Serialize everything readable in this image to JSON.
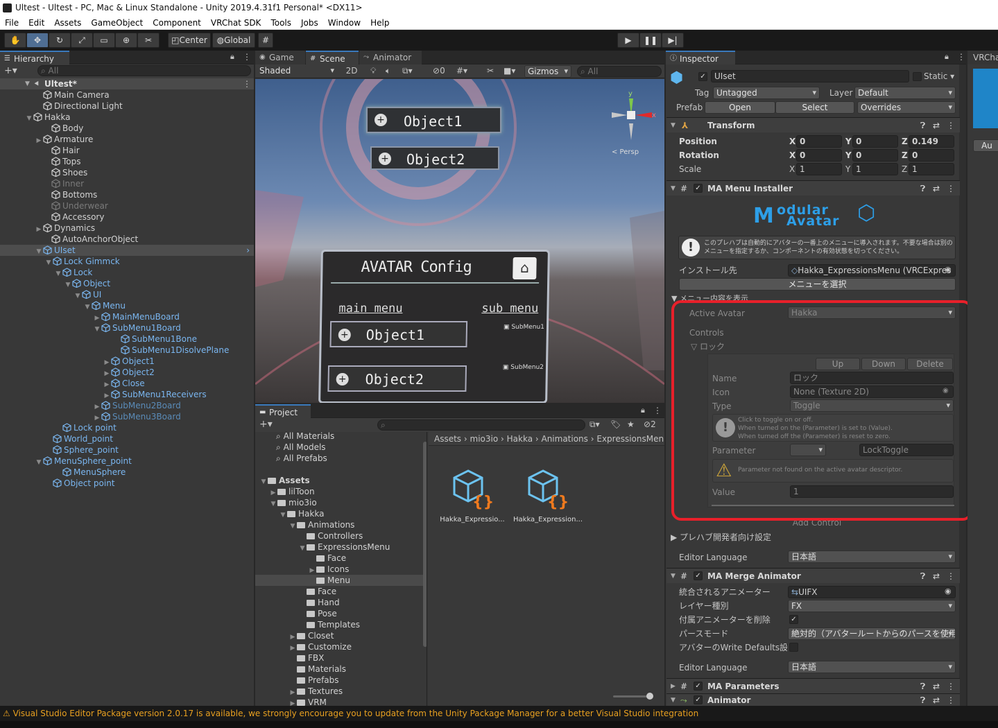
{
  "window_title": "Ultest - Ultest - PC, Mac & Linux Standalone - Unity 2019.4.31f1 Personal* <DX11>",
  "menu": [
    "File",
    "Edit",
    "Assets",
    "GameObject",
    "Component",
    "VRChat SDK",
    "Tools",
    "Jobs",
    "Window",
    "Help"
  ],
  "toolbar": {
    "pivot": "Center",
    "space": "Global"
  },
  "hierarchy": {
    "tab": "Hierarchy",
    "search_placeholder": "All",
    "scene": "Ultest*",
    "items": [
      {
        "label": "Main Camera",
        "style": ""
      },
      {
        "label": "Directional Light",
        "style": ""
      },
      {
        "label": "Hakka",
        "style": ""
      },
      {
        "label": "Body",
        "style": ""
      },
      {
        "label": "Armature",
        "style": ""
      },
      {
        "label": "Hair",
        "style": ""
      },
      {
        "label": "Tops",
        "style": ""
      },
      {
        "label": "Shoes",
        "style": ""
      },
      {
        "label": "Inner",
        "style": "dim"
      },
      {
        "label": "Bottoms",
        "style": ""
      },
      {
        "label": "Underwear",
        "style": "dim"
      },
      {
        "label": "Accessory",
        "style": ""
      },
      {
        "label": "Dynamics",
        "style": ""
      },
      {
        "label": "AutoAnchorObject",
        "style": ""
      },
      {
        "label": "UIset",
        "style": "sel"
      },
      {
        "label": "Lock Gimmck",
        "style": "blue"
      },
      {
        "label": "Lock",
        "style": "blue"
      },
      {
        "label": "Object",
        "style": "blue"
      },
      {
        "label": "UI",
        "style": "blue"
      },
      {
        "label": "Menu",
        "style": "blue"
      },
      {
        "label": "MainMenuBoard",
        "style": "blue"
      },
      {
        "label": "SubMenu1Board",
        "style": "blue"
      },
      {
        "label": "SubMenu1Bone",
        "style": "blue"
      },
      {
        "label": "SubMenu1DisolvePlane",
        "style": "blue"
      },
      {
        "label": "Object1",
        "style": "blue"
      },
      {
        "label": "Object2",
        "style": "blue"
      },
      {
        "label": "Close",
        "style": "blue"
      },
      {
        "label": "SubMenu1Receivers",
        "style": "blue"
      },
      {
        "label": "SubMenu2Board",
        "style": "bluedim"
      },
      {
        "label": "SubMenu3Board",
        "style": "bluedim"
      },
      {
        "label": "Lock point",
        "style": "blue"
      },
      {
        "label": "World_point",
        "style": "blue"
      },
      {
        "label": "Sphere_point",
        "style": "blue"
      },
      {
        "label": "MenuSphere_point",
        "style": "blue"
      },
      {
        "label": "MenuSphere",
        "style": "blue"
      },
      {
        "label": "Object point",
        "style": "blue"
      }
    ]
  },
  "scene_view": {
    "tabs": [
      "Game",
      "Scene",
      "Animator"
    ],
    "shading": "Shaded",
    "mode_2d": "2D",
    "gizmos": "Gizmos",
    "search_placeholder": "All",
    "persp": "< Persp",
    "effects_count": "0",
    "ui": {
      "top_buttons": [
        "Object1",
        "Object2"
      ],
      "config_title": "AVATAR Config",
      "main_menu": "main menu",
      "sub_menu": "sub menu",
      "panel_buttons": [
        "Object1",
        "Object2"
      ],
      "sub_items": [
        "SubMenu1",
        "SubMenu2"
      ]
    }
  },
  "project": {
    "tab": "Project",
    "hidden_count": "2",
    "favorites": [
      "All Materials",
      "All Models",
      "All Prefabs"
    ],
    "tree": [
      "Assets",
      "lilToon",
      "mio3io",
      "Hakka",
      "Animations",
      "Controllers",
      "ExpressionsMenu",
      "Face",
      "Icons",
      "Menu",
      "Face",
      "Hand",
      "Pose",
      "Templates",
      "Closet",
      "Customize",
      "FBX",
      "Materials",
      "Prefabs",
      "Textures",
      "VRM"
    ],
    "breadcrumb": [
      "Assets",
      "mio3io",
      "Hakka",
      "Animations",
      "ExpressionsMenu"
    ],
    "assets": [
      "Hakka_Expressio...",
      "Hakka_Expression..."
    ]
  },
  "inspector": {
    "tab": "Inspector",
    "object_name": "UIset",
    "static_label": "Static",
    "tag_label": "Tag",
    "tag": "Untagged",
    "layer_label": "Layer",
    "layer": "Default",
    "prefab_label": "Prefab",
    "prefab_buttons": [
      "Open",
      "Select",
      "Overrides"
    ],
    "transform": {
      "title": "Transform",
      "position_label": "Position",
      "rotation_label": "Rotation",
      "scale_label": "Scale",
      "position": [
        "0",
        "0",
        "0.149"
      ],
      "rotation": [
        "0",
        "0",
        "0"
      ],
      "scale": [
        "1",
        "1",
        "1"
      ]
    },
    "menu_installer": {
      "title": "MA Menu Installer",
      "logo_line1": "odular",
      "logo_line2": "Avatar",
      "info": "このプレハブは自動的にアバターの一番上のメニューに導入されます。不要な場合は別のメニューを指定するか、コンポーネントの有効状態を切ってください。",
      "install_target_label": "インストール先",
      "install_target": "Hakka_ExpressionsMenu (VRCExpres",
      "select_menu": "メニューを選択",
      "show_contents": "メニュー内容を表示",
      "active_avatar_label": "Active Avatar",
      "active_avatar": "Hakka",
      "controls_label": "Controls",
      "control_name": "ロック",
      "up": "Up",
      "down": "Down",
      "delete": "Delete",
      "name_label": "Name",
      "name": "ロック",
      "icon_label": "Icon",
      "icon": "None (Texture 2D)",
      "type_label": "Type",
      "type": "Toggle",
      "toggle_help_1": "Click to toggle on or off.",
      "toggle_help_2": "When turned on the (Parameter) is set to (Value).",
      "toggle_help_3": "When turned off the (Parameter) is reset to zero.",
      "parameter_label": "Parameter",
      "parameter": "LockToggle",
      "warning": "Parameter not found on the active avatar descriptor.",
      "value_label": "Value",
      "value": "1",
      "add_control": "Add Control",
      "prefab_dev": "プレハブ開発者向け設定",
      "editor_language_label": "Editor Language",
      "editor_language": "日本語"
    },
    "merge_animator": {
      "title": "MA Merge Animator",
      "animator_label": "統合されるアニメーター",
      "animator": "UIFX",
      "layer_type_label": "レイヤー種別",
      "layer_type": "FX",
      "delete_attached_label": "付属アニメーターを削除",
      "path_mode_label": "パースモード",
      "path_mode": "絶対的（アバタールートからのパースを使用）",
      "write_defaults_label": "アバターのWrite Defaults設定に",
      "editor_language_label": "Editor Language",
      "editor_language": "日本語"
    },
    "parameters_title": "MA Parameters",
    "animator_title": "Animator"
  },
  "right_tab": "VRCha",
  "right_button": "Au",
  "status": "Visual Studio Editor Package version 2.0.17 is available, we strongly encourage you to update from the Unity Package Manager for a better Visual Studio integration",
  "colors": {
    "highlight": "#e8202a",
    "link": "#7ab6f0",
    "selection": "#2c5d87",
    "accent": "#3a79bb"
  }
}
